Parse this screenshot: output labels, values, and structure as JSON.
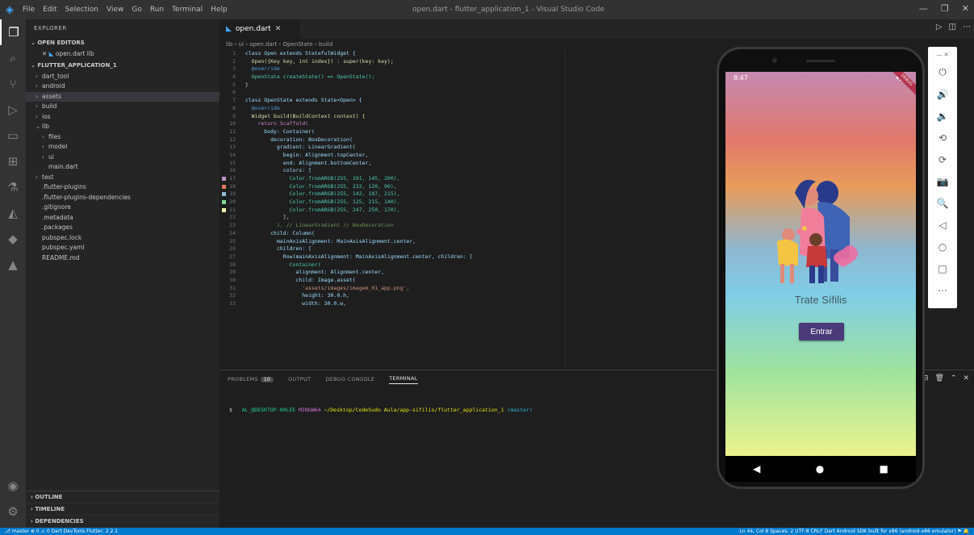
{
  "window": {
    "title": "open.dart - flutter_application_1 - Visual Studio Code",
    "menu": [
      "File",
      "Edit",
      "Selection",
      "View",
      "Go",
      "Run",
      "Terminal",
      "Help"
    ],
    "controls": [
      "—",
      "❐",
      "✕"
    ]
  },
  "activity": [
    "explorer-icon",
    "search-icon",
    "source-control-icon",
    "run-debug-icon",
    "remote-icon",
    "extensions-icon",
    "testing-icon",
    "flutter-icon",
    "docker-icon",
    "deploy-icon"
  ],
  "sidebar": {
    "title": "EXPLORER",
    "open_editors_label": "OPEN EDITORS",
    "open_editors": [
      {
        "label": "open.dart lib"
      }
    ],
    "project_label": "FLUTTER_APPLICATION_1",
    "tree": [
      {
        "label": "dart_tool",
        "indent": 1,
        "chev": "›"
      },
      {
        "label": "android",
        "indent": 1,
        "chev": "›"
      },
      {
        "label": "assets",
        "indent": 1,
        "chev": "›",
        "selected": true
      },
      {
        "label": "build",
        "indent": 1,
        "chev": "›"
      },
      {
        "label": "ios",
        "indent": 1,
        "chev": "›"
      },
      {
        "label": "lib",
        "indent": 1,
        "chev": "⌄"
      },
      {
        "label": "files",
        "indent": 2,
        "chev": "›"
      },
      {
        "label": "model",
        "indent": 2,
        "chev": "›"
      },
      {
        "label": "ui",
        "indent": 2,
        "chev": "›"
      },
      {
        "label": "main.dart",
        "indent": 2,
        "chev": ""
      },
      {
        "label": "test",
        "indent": 1,
        "chev": "›"
      },
      {
        "label": ".flutter-plugins",
        "indent": 1,
        "chev": ""
      },
      {
        "label": ".flutter-plugins-dependencies",
        "indent": 1,
        "chev": ""
      },
      {
        "label": ".gitignore",
        "indent": 1,
        "chev": ""
      },
      {
        "label": ".metadata",
        "indent": 1,
        "chev": ""
      },
      {
        "label": ".packages",
        "indent": 1,
        "chev": ""
      },
      {
        "label": "pubspec.lock",
        "indent": 1,
        "chev": ""
      },
      {
        "label": "pubspec.yaml",
        "indent": 1,
        "chev": ""
      },
      {
        "label": "README.md",
        "indent": 1,
        "chev": ""
      }
    ],
    "footer_sections": [
      "OUTLINE",
      "TIMELINE",
      "DEPENDENCIES"
    ]
  },
  "editor": {
    "tab_label": "open.dart",
    "breadcrumb": "lib › ui › open.dart › OpenState › build",
    "code_lines": [
      {
        "n": "1",
        "t": "  class Open extends StatefulWidget {",
        "c": "#9cdcfe"
      },
      {
        "n": "2",
        "t": "    Open({Key key, int index}) : super(key: key);",
        "c": "#dcdcaa"
      },
      {
        "n": "3",
        "t": "    @override",
        "c": "#569cd6"
      },
      {
        "n": "4",
        "t": "    OpenState createState() => OpenState();",
        "c": "#4ec9b0"
      },
      {
        "n": "5",
        "t": "  }",
        "c": "#d4d4d4"
      },
      {
        "n": "6",
        "t": "",
        "c": "#d4d4d4"
      },
      {
        "n": "7",
        "t": "  class OpenState extends State<Open> {",
        "c": "#9cdcfe"
      },
      {
        "n": "8",
        "t": "    @override",
        "c": "#569cd6"
      },
      {
        "n": "9",
        "t": "    Widget build(BuildContext context) {",
        "c": "#dcdcaa"
      },
      {
        "n": "10",
        "t": "      return Scaffold(",
        "c": "#c586c0"
      },
      {
        "n": "11",
        "t": "        body: Container(",
        "c": "#9cdcfe"
      },
      {
        "n": "12",
        "t": "          decoration: BoxDecoration(",
        "c": "#9cdcfe"
      },
      {
        "n": "13",
        "t": "            gradient: LinearGradient(",
        "c": "#9cdcfe"
      },
      {
        "n": "14",
        "t": "              begin: Alignment.topCenter,",
        "c": "#9cdcfe"
      },
      {
        "n": "15",
        "t": "              end: Alignment.bottomCenter,",
        "c": "#9cdcfe"
      },
      {
        "n": "16",
        "t": "              colors: [",
        "c": "#9cdcfe"
      },
      {
        "n": "17",
        "t": "                Color.fromARGB(255, 191, 145, 200),",
        "c": "#4ec9b0",
        "sw": "#bf91c8"
      },
      {
        "n": "18",
        "t": "                Color.fromARGB(255, 232, 120, 90),",
        "c": "#4ec9b0",
        "sw": "#e8785a"
      },
      {
        "n": "19",
        "t": "                Color.fromARGB(255, 142, 187, 215),",
        "c": "#4ec9b0",
        "sw": "#8ebbd7"
      },
      {
        "n": "20",
        "t": "                Color.fromARGB(255, 125, 215, 140),",
        "c": "#4ec9b0",
        "sw": "#7dd78c"
      },
      {
        "n": "21",
        "t": "                Color.fromARGB(255, 247, 250, 170),",
        "c": "#4ec9b0",
        "sw": "#f7faaa"
      },
      {
        "n": "22",
        "t": "              ],",
        "c": "#d4d4d4"
      },
      {
        "n": "23",
        "t": "            ), // LinearGradient // BoxDecoration",
        "c": "#6a9955"
      },
      {
        "n": "24",
        "t": "          child: Column(",
        "c": "#9cdcfe"
      },
      {
        "n": "25",
        "t": "            mainAxisAlignment: MainAxisAlignment.center,",
        "c": "#9cdcfe"
      },
      {
        "n": "26",
        "t": "            children: [",
        "c": "#9cdcfe"
      },
      {
        "n": "27",
        "t": "              Row(mainAxisAlignment: MainAxisAlignment.center, children: [",
        "c": "#9cdcfe"
      },
      {
        "n": "28",
        "t": "                Container(",
        "c": "#4ec9b0"
      },
      {
        "n": "29",
        "t": "                  alignment: Alignment.center,",
        "c": "#9cdcfe"
      },
      {
        "n": "30",
        "t": "                  child: Image.asset(",
        "c": "#9cdcfe"
      },
      {
        "n": "31",
        "t": "                    'assets/images/imagem_01_app.png',",
        "c": "#ce9178"
      },
      {
        "n": "32",
        "t": "                    height: 30.0.h,",
        "c": "#9cdcfe"
      },
      {
        "n": "33",
        "t": "                    width: 30.0.w,",
        "c": "#9cdcfe"
      }
    ]
  },
  "panel": {
    "tabs": [
      "PROBLEMS",
      "OUTPUT",
      "DEBUG CONSOLE",
      "TERMINAL"
    ],
    "problems_badge": "10",
    "active_tab": "TERMINAL",
    "actions": [
      "+",
      "⌄",
      "⊟",
      "🗑",
      "⌃",
      "✕"
    ],
    "terminal_prompt_user": "AL_@DESKTOP-00LEE",
    "terminal_prompt_shell": "MINGW64",
    "terminal_prompt_path": "~/Desktop/CodeSudo Aula/app-sifilis/flutter_application_1",
    "terminal_prompt_branch": "(master)",
    "terminal_cursor": "$"
  },
  "statusbar": {
    "left": "⎇ master   ⊗ 0 ⚠ 0   Dart DevTools   Flutter: 2.2.1",
    "right": "Ln 44, Col 8   Spaces: 2   UTF-8   CRLF   Dart   Android SDK built for x86 (android-x86 emulator)   ⚑   🔔"
  },
  "emulator": {
    "status_time": "8:47",
    "status_icons": "▾◢▮",
    "debug_banner": "DEBUG",
    "app_title": "Trate Sífilis",
    "button_label": "Entrar",
    "nav": [
      "◀",
      "●",
      "■"
    ],
    "tools": [
      "power-icon",
      "volume-up-icon",
      "volume-down-icon",
      "rotate-left-icon",
      "rotate-right-icon",
      "camera-icon",
      "zoom-icon",
      "back-icon",
      "home-icon",
      "overview-icon",
      "more-icon"
    ],
    "tool_glyphs": [
      "⏻",
      "🔊",
      "🔉",
      "⟲",
      "⟳",
      "📷",
      "🔍",
      "◁",
      "○",
      "□",
      "⋯"
    ],
    "window_controls": "—  ✕"
  }
}
